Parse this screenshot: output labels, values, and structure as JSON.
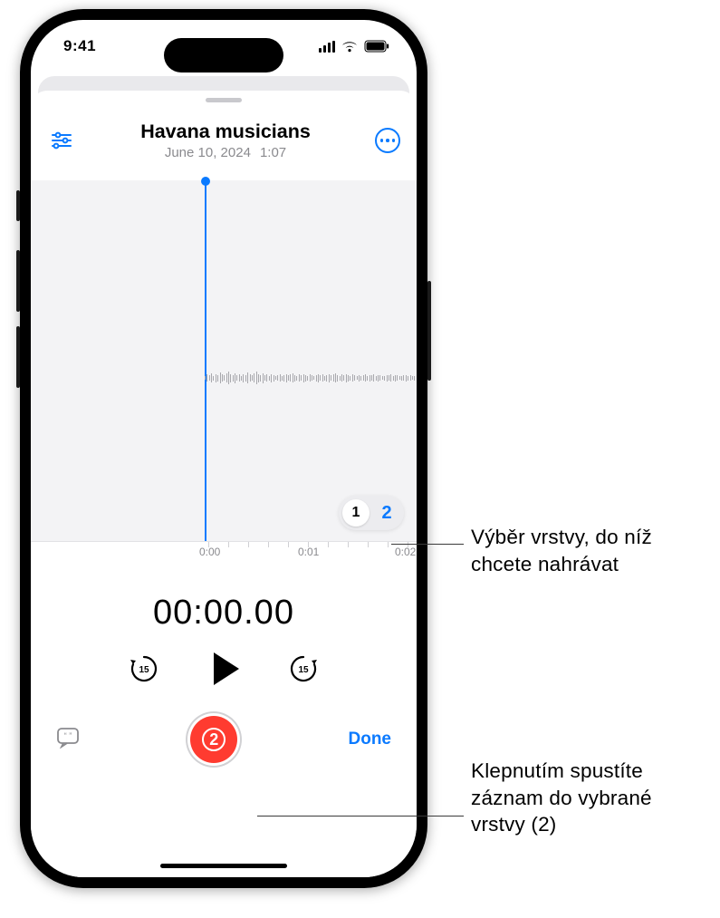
{
  "status": {
    "time": "9:41"
  },
  "header": {
    "title": "Havana musicians",
    "date": "June 10, 2024",
    "duration": "1:07"
  },
  "ruler": {
    "t0": "0:00",
    "t1": "0:01",
    "t2": "0:02"
  },
  "layers": {
    "opt1": "1",
    "opt2": "2",
    "selected": 2
  },
  "timer": "00:00.00",
  "skip_seconds": "15",
  "record": {
    "layer_badge": "2"
  },
  "done_label": "Done",
  "callouts": {
    "layer_select": "Výběr vrstvy, do níž chcete nahrávat",
    "record_into": "Klepnutím spustíte záznam do vybrané vrstvy (2)"
  },
  "colors": {
    "accent": "#0a7aff",
    "record": "#ff3b30",
    "muted": "#8a8a8e",
    "panel": "#f3f3f5"
  }
}
